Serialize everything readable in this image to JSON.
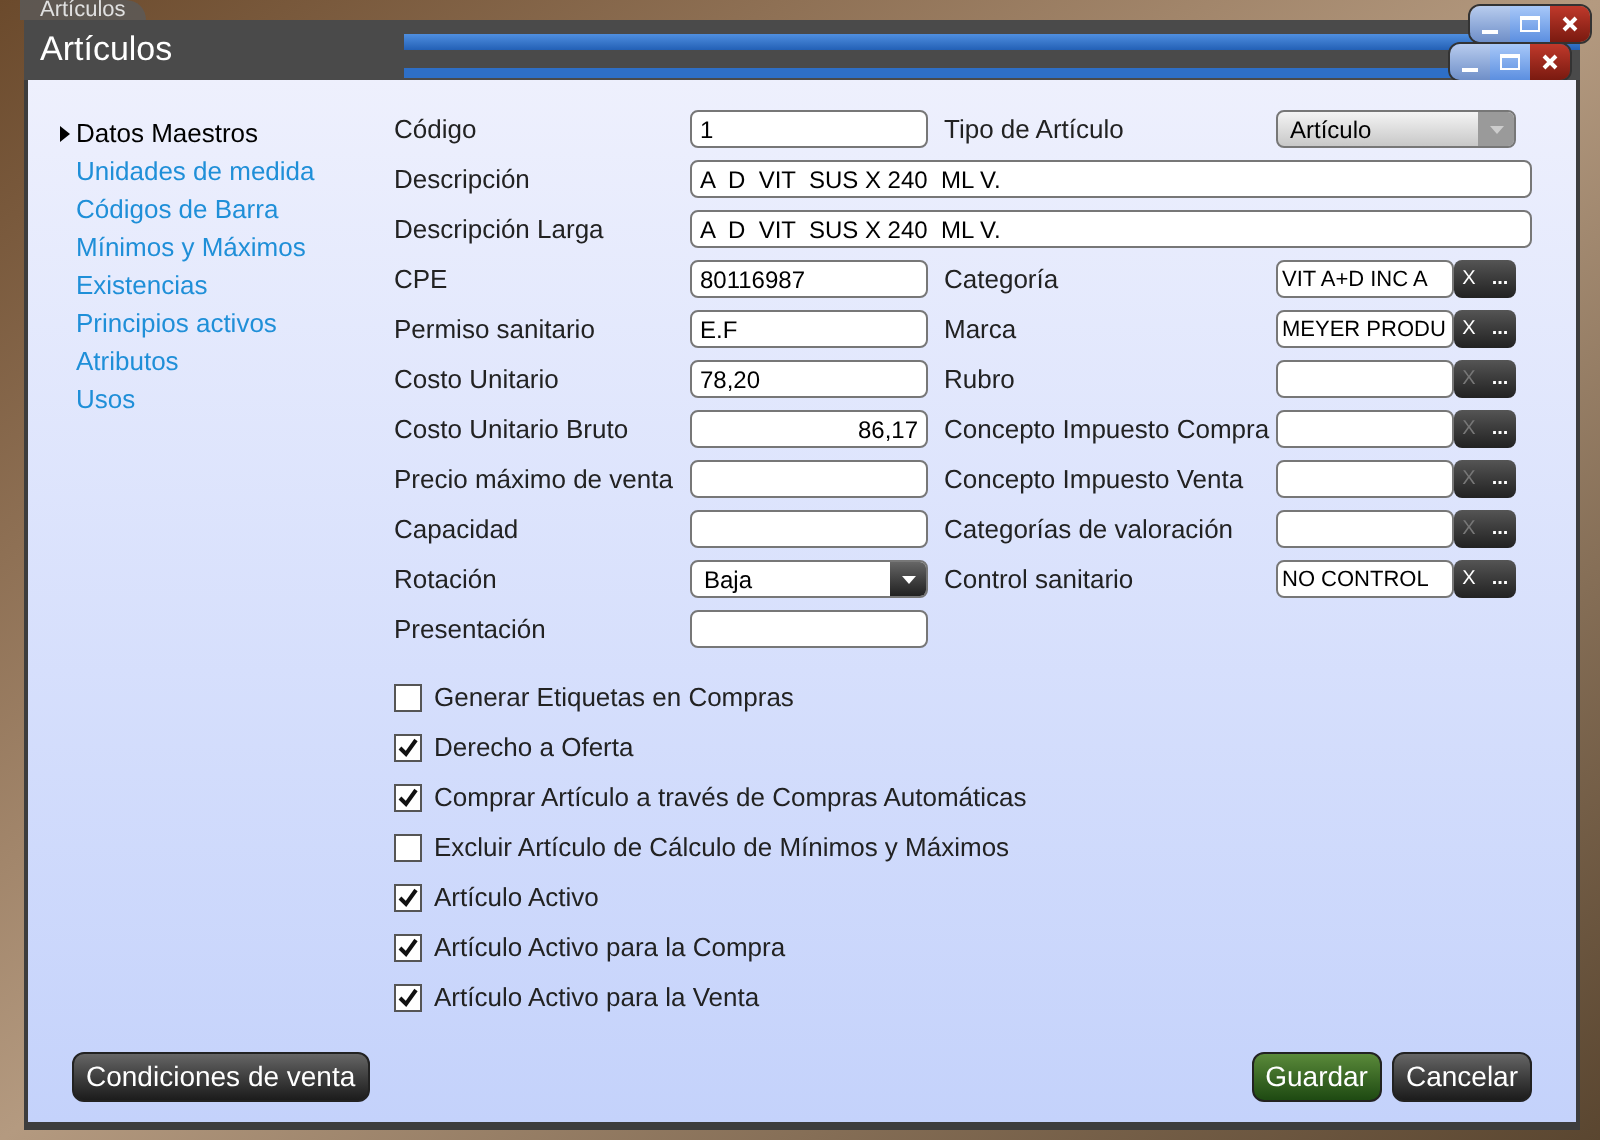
{
  "background_window": {
    "title": "Artículos"
  },
  "window": {
    "title": "Artículos"
  },
  "sidebar": {
    "items": [
      {
        "label": "Datos Maestros",
        "selected": true
      },
      {
        "label": "Unidades de medida",
        "selected": false
      },
      {
        "label": "Códigos de Barra",
        "selected": false
      },
      {
        "label": "Mínimos y Máximos",
        "selected": false
      },
      {
        "label": "Existencias",
        "selected": false
      },
      {
        "label": "Principios activos",
        "selected": false
      },
      {
        "label": "Atributos",
        "selected": false
      },
      {
        "label": "Usos",
        "selected": false
      }
    ]
  },
  "rows": [
    {
      "label": "Código",
      "field": {
        "kind": "text",
        "value": "1"
      },
      "right": {
        "label": "Tipo de Artículo",
        "field": {
          "kind": "select",
          "value": "Artículo",
          "disabled": true
        }
      }
    },
    {
      "label": "Descripción",
      "field": {
        "kind": "wide",
        "value": "A  D  VIT  SUS X 240  ML V."
      }
    },
    {
      "label": "Descripción Larga",
      "field": {
        "kind": "wide",
        "value": "A  D  VIT  SUS X 240  ML V."
      }
    },
    {
      "label": "CPE",
      "field": {
        "kind": "text",
        "value": "80116987"
      },
      "right": {
        "label": "Categoría",
        "field": {
          "kind": "lookup",
          "value": "VIT A+D INC A",
          "clear": "X",
          "browse": "...",
          "clear_enabled": true
        }
      }
    },
    {
      "label": "Permiso sanitario",
      "field": {
        "kind": "text",
        "value": "E.F"
      },
      "right": {
        "label": "Marca",
        "field": {
          "kind": "lookup",
          "value": "MEYER PRODU",
          "clear": "X",
          "browse": "...",
          "clear_enabled": true
        }
      }
    },
    {
      "label": "Costo Unitario",
      "field": {
        "kind": "text",
        "value": "78,20"
      },
      "right": {
        "label": "Rubro",
        "field": {
          "kind": "lookup",
          "clear": "X",
          "browse": "...",
          "clear_enabled": false
        }
      }
    },
    {
      "label": "Costo Unitario Bruto",
      "field": {
        "kind": "number",
        "value": "86,17"
      },
      "right": {
        "label": "Concepto Impuesto Compra",
        "field": {
          "kind": "lookup",
          "clear": "X",
          "browse": "...",
          "clear_enabled": false
        }
      }
    },
    {
      "label": "Precio máximo de venta",
      "field": {
        "kind": "text"
      },
      "right": {
        "label": "Concepto Impuesto Venta",
        "field": {
          "kind": "lookup",
          "clear": "X",
          "browse": "...",
          "clear_enabled": false
        }
      }
    },
    {
      "label": "Capacidad",
      "field": {
        "kind": "text"
      },
      "right": {
        "label": "Categorías de valoración",
        "field": {
          "kind": "lookup",
          "clear": "X",
          "browse": "...",
          "clear_enabled": false
        }
      }
    },
    {
      "label": "Rotación",
      "field": {
        "kind": "select",
        "value": "Baja",
        "disabled": false
      },
      "right": {
        "label": "Control sanitario",
        "field": {
          "kind": "lookup",
          "value": "NO CONTROL",
          "clear": "X",
          "browse": "...",
          "clear_enabled": true
        }
      }
    },
    {
      "label": "Presentación",
      "field": {
        "kind": "text"
      }
    }
  ],
  "checkboxes": [
    {
      "label": "Generar Etiquetas en Compras",
      "checked": false
    },
    {
      "label": "Derecho a Oferta",
      "checked": true
    },
    {
      "label": "Comprar Artículo a través de Compras Automáticas",
      "checked": true
    },
    {
      "label": "Excluir Artículo de Cálculo de Mínimos y Máximos",
      "checked": false
    },
    {
      "label": "Artículo Activo",
      "checked": true
    },
    {
      "label": "Artículo Activo para la Compra",
      "checked": true
    },
    {
      "label": "Artículo Activo para la Venta",
      "checked": true
    }
  ],
  "buttons": [
    {
      "label": "Condiciones de venta",
      "kind": "secondary"
    },
    {
      "label": "Guardar",
      "kind": "primary"
    },
    {
      "label": "Cancelar",
      "kind": "secondary"
    }
  ]
}
